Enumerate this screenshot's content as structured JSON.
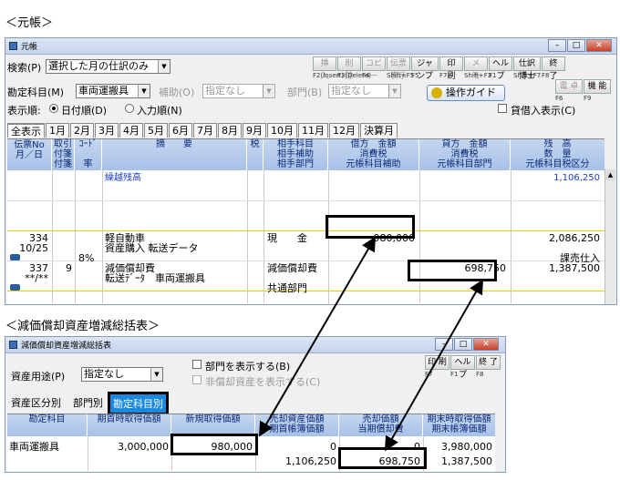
{
  "captions": {
    "top": "＜元帳＞",
    "bottom": "＜減価償却資産増減総括表＞"
  },
  "ledger": {
    "title": "元帳",
    "search_label": "検索(P)",
    "search_value": "選択した月の仕訳のみ",
    "toolbar": [
      {
        "label": "挿 入",
        "fkey": "F2(Insert)",
        "enabled": false
      },
      {
        "label": "削 除",
        "fkey": "F3(Delete)",
        "enabled": false
      },
      {
        "label": "コピー",
        "fkey": "F4",
        "enabled": false
      },
      {
        "label": "伝票表示",
        "fkey": "Shift+F5",
        "enabled": false
      },
      {
        "label": "ジャンプ",
        "fkey": "F5",
        "enabled": true
      },
      {
        "label": "印 刷",
        "fkey": "F7",
        "enabled": true
      },
      {
        "label": "メ モ",
        "fkey": "Shift+F3",
        "enabled": false
      },
      {
        "label": "ヘルプ",
        "fkey": "F1",
        "enabled": true
      },
      {
        "label": "仕訳博士",
        "fkey": "Shift+F7",
        "enabled": true
      },
      {
        "label": "終 了",
        "fkey": "F8",
        "enabled": true
      }
    ],
    "toolbar2": [
      {
        "label": "電 卓",
        "fkey": "F6",
        "enabled": false
      },
      {
        "label": "機 能",
        "fkey": "F9",
        "enabled": true
      }
    ],
    "account_label": "勘定科目(M)",
    "account_value": "車両運搬具",
    "aux_label": "補助(O)",
    "aux_value": "指定なし",
    "dept_label": "部門(B)",
    "dept_value": "指定なし",
    "guide_button": "操作ガイド",
    "order_label": "表示順:",
    "order_date": "日付順(D)",
    "order_input": "入力順(N)",
    "loan_label": "貸借入表示(C)",
    "month_tabs": [
      "全表示",
      "1月",
      "2月",
      "3月",
      "4月",
      "5月",
      "6月",
      "7月",
      "8月",
      "9月",
      "10月",
      "11月",
      "12月",
      "決算月"
    ],
    "headers": {
      "col1": [
        "伝票No",
        "月／日"
      ],
      "col2": [
        "取引",
        "付箋",
        "付箋"
      ],
      "col3": [
        "ｺｰﾄﾞ",
        "",
        "率"
      ],
      "col4": "摘　　要",
      "col5": "税",
      "col6": [
        "相手科目",
        "相手補助",
        "相手部門"
      ],
      "col7": [
        "借方　金額",
        "消費税",
        "元帳科目補助"
      ],
      "col8": [
        "貸方　金額",
        "消費税",
        "元帳科目部門"
      ],
      "col9": [
        "残　高",
        "数　量",
        "元帳科目税区分"
      ]
    },
    "rows": {
      "carry_label": "繰越残高",
      "carry_balance": "1,106,250",
      "r1_no": "334",
      "r1_date": "10/25",
      "r1_rate": "8%",
      "r1_desc1": "軽自動車",
      "r1_desc2": "資産購入 転送データ",
      "r1_partner": "現　　金",
      "r1_debit": "980,000",
      "r1_balance": "2,086,250",
      "r1_taxcat": "課売仕入",
      "r2_no": "337",
      "r2_code": "9",
      "r2_date": "**/**",
      "r2_desc1": "減価償却費",
      "r2_desc2": "転送ﾃﾞｰﾀ　車両運搬具",
      "r2_partner": "減価償却費",
      "r2_partner_dept": "共通部門",
      "r2_credit": "698,750",
      "r2_balance": "1,387,500"
    }
  },
  "summary": {
    "title": "減価償却資産増減総括表",
    "toolbar": [
      {
        "label": "印 刷",
        "fkey": "F7"
      },
      {
        "label": "ヘルプ",
        "fkey": "F1"
      },
      {
        "label": "終 了",
        "fkey": "F8"
      }
    ],
    "usage_label": "資産用途(P)",
    "usage_value": "指定なし",
    "dept_show": "部門を表示する(B)",
    "non_dep_show": "非償却資産を表示する(C)",
    "tabs": [
      "資産区分別",
      "部門別",
      "勘定科目別"
    ],
    "headers": {
      "h1": "勘定科目",
      "h2": "期首時取得価額",
      "h3": "新規取得価額",
      "h4": [
        "売却資産価額",
        "期首帳簿価額"
      ],
      "h5": [
        "売却価額",
        "当期償却費"
      ],
      "h6": [
        "期末時取得価額",
        "期末帳簿価額"
      ]
    },
    "row": {
      "account": "車両運搬具",
      "beginning": "3,000,000",
      "new": "980,000",
      "sold": "0",
      "sold_price": "0",
      "end_acq": "3,980,000",
      "beg_book": "1,106,250",
      "depr": "698,750",
      "end_book": "1,387,500"
    }
  }
}
